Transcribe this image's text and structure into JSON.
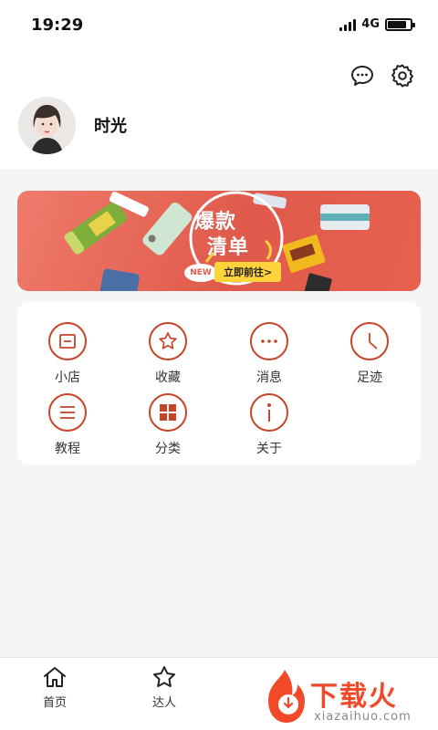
{
  "status_bar": {
    "time": "19:29",
    "network": "4G"
  },
  "profile": {
    "username": "时光"
  },
  "banner": {
    "title_line1": "爆款",
    "title_line2": "清单",
    "badge": "NEW",
    "cta": "立即前往>"
  },
  "grid": {
    "items": [
      {
        "label": "小店",
        "icon": "shop-icon"
      },
      {
        "label": "收藏",
        "icon": "star-icon"
      },
      {
        "label": "消息",
        "icon": "message-icon"
      },
      {
        "label": "足迹",
        "icon": "clock-icon"
      },
      {
        "label": "教程",
        "icon": "list-icon"
      },
      {
        "label": "分类",
        "icon": "grid-icon"
      },
      {
        "label": "关于",
        "icon": "info-icon"
      }
    ]
  },
  "tabs": [
    {
      "label": "首页",
      "icon": "home-icon"
    },
    {
      "label": "达人",
      "icon": "star-icon"
    }
  ],
  "watermark": {
    "text": "下载火",
    "url": "xiazaihuo.com"
  },
  "colors": {
    "accent": "#c8452a",
    "banner": "#e05a4b",
    "cta": "#ffd33a"
  }
}
